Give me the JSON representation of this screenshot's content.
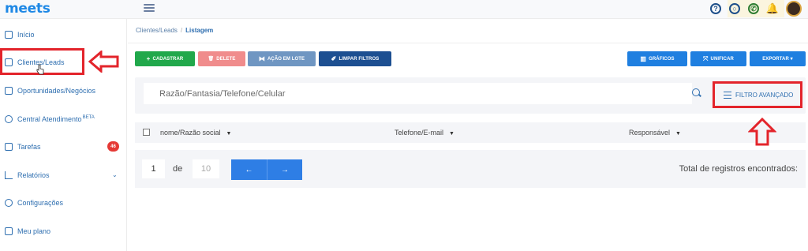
{
  "app": {
    "logo": "meets"
  },
  "topbar": {
    "icons": [
      "help-icon",
      "chat-icon",
      "whatsapp-icon",
      "bell-icon"
    ],
    "help_glyph": "?",
    "chat_glyph": "○",
    "whatsapp_glyph": "✆",
    "bell_glyph": "🔔"
  },
  "sidebar": {
    "items": [
      {
        "label": "Início"
      },
      {
        "label": "Clientes/Leads"
      },
      {
        "label": "Oportunidades/Negócios"
      },
      {
        "label": "Central Atendimento",
        "sup": "BETA"
      },
      {
        "label": "Tarefas",
        "badge": "46"
      },
      {
        "label": "Relatórios",
        "chevron": "⌄"
      },
      {
        "label": "Configurações"
      },
      {
        "label": "Meu plano"
      }
    ]
  },
  "breadcrumb": {
    "parent": "Clientes/Leads",
    "separator": "/",
    "current": "Listagem"
  },
  "toolbar": {
    "cadastrar": "CADASTRAR",
    "delete": "DELETE",
    "acao_lote": "AÇÃO EM LOTE",
    "limpar": "LIMPAR FILTROS",
    "graficos": "GRÁFICOS",
    "unificar": "UNIFICAR",
    "exportar": "EXPORTAR ▾",
    "icons": {
      "cadastrar": "+",
      "delete": "🗑",
      "acao_lote": "⧓",
      "limpar": "✐",
      "graficos": "▥",
      "unificar": "⤧"
    }
  },
  "search": {
    "placeholder": "Razão/Fantasia/Telefone/Celular",
    "advanced_filter": "FILTRO AVANÇADO"
  },
  "table": {
    "columns": [
      "nome/Razão social",
      "Telefone/E-mail",
      "Responsável"
    ],
    "caret": "▼"
  },
  "pagination": {
    "current_page": "1",
    "de": "de",
    "total_pages": "10",
    "prev": "←",
    "next": "→",
    "total_label": "Total de registros encontrados:"
  },
  "colors": {
    "brand": "#1e88e5",
    "cadastrar": "#21a84b",
    "delete": "#f08c8c",
    "acao_lote": "#6f96c2",
    "limpar": "#1d4f91",
    "primary_blue": "#1f7fe0",
    "annotation_red": "#e3242b"
  }
}
